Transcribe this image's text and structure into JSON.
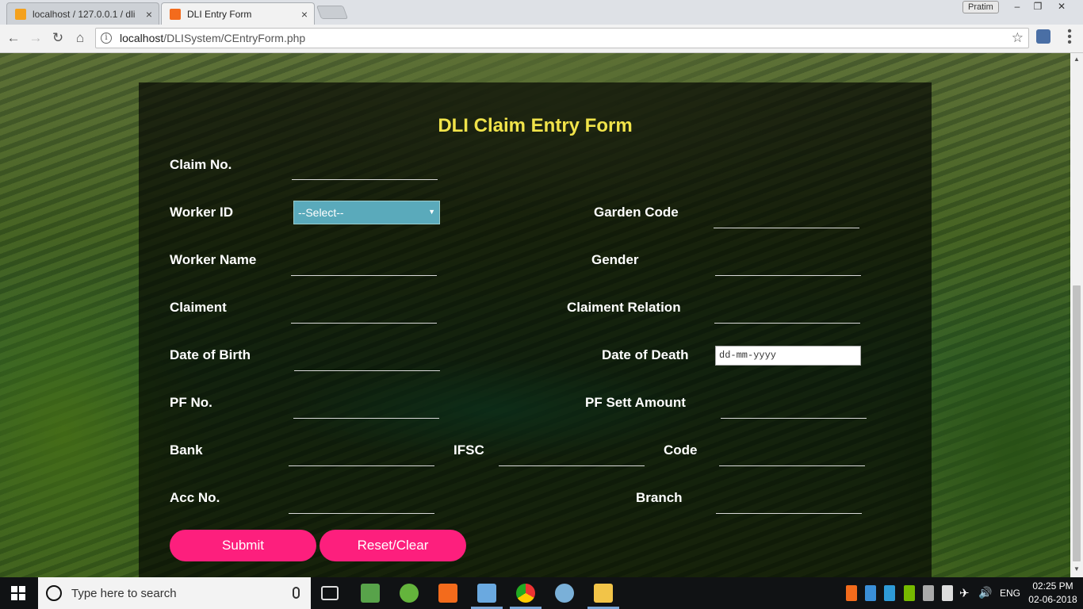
{
  "browser": {
    "tabs": [
      {
        "title": "localhost / 127.0.0.1 / dli",
        "active": false
      },
      {
        "title": "DLI Entry Form",
        "active": true
      }
    ],
    "close_glyph": "×",
    "profile_name": "Pratim",
    "url_host": "localhost",
    "url_path": "/DLISystem/CEntryForm.php",
    "info_glyph": "i",
    "star_glyph": "☆"
  },
  "form": {
    "title": "DLI Claim Entry Form",
    "labels": {
      "claim_no": "Claim No.",
      "worker_id": "Worker ID",
      "garden_code": "Garden Code",
      "worker_name": "Worker Name",
      "gender": "Gender",
      "claiment": "Claiment",
      "claiment_relation": "Claiment Relation",
      "date_of_birth": "Date of Birth",
      "date_of_death": "Date of Death",
      "pf_no": "PF No.",
      "pf_sett_amount": "PF Sett Amount",
      "bank": "Bank",
      "ifsc": "IFSC",
      "code": "Code",
      "acc_no": "Acc No.",
      "branch": "Branch"
    },
    "worker_select_value": "--Select--",
    "date_placeholder": "dd-mm-yyyy",
    "submit_label": "Submit",
    "reset_label": "Reset/Clear"
  },
  "taskbar": {
    "search_placeholder": "Type here to search",
    "language": "ENG",
    "time": "02:25 PM",
    "date": "02-06-2018"
  },
  "colors": {
    "title_yellow": "#f0e34a",
    "button_pink": "#fd1f7d",
    "select_teal": "#5aaabb"
  }
}
